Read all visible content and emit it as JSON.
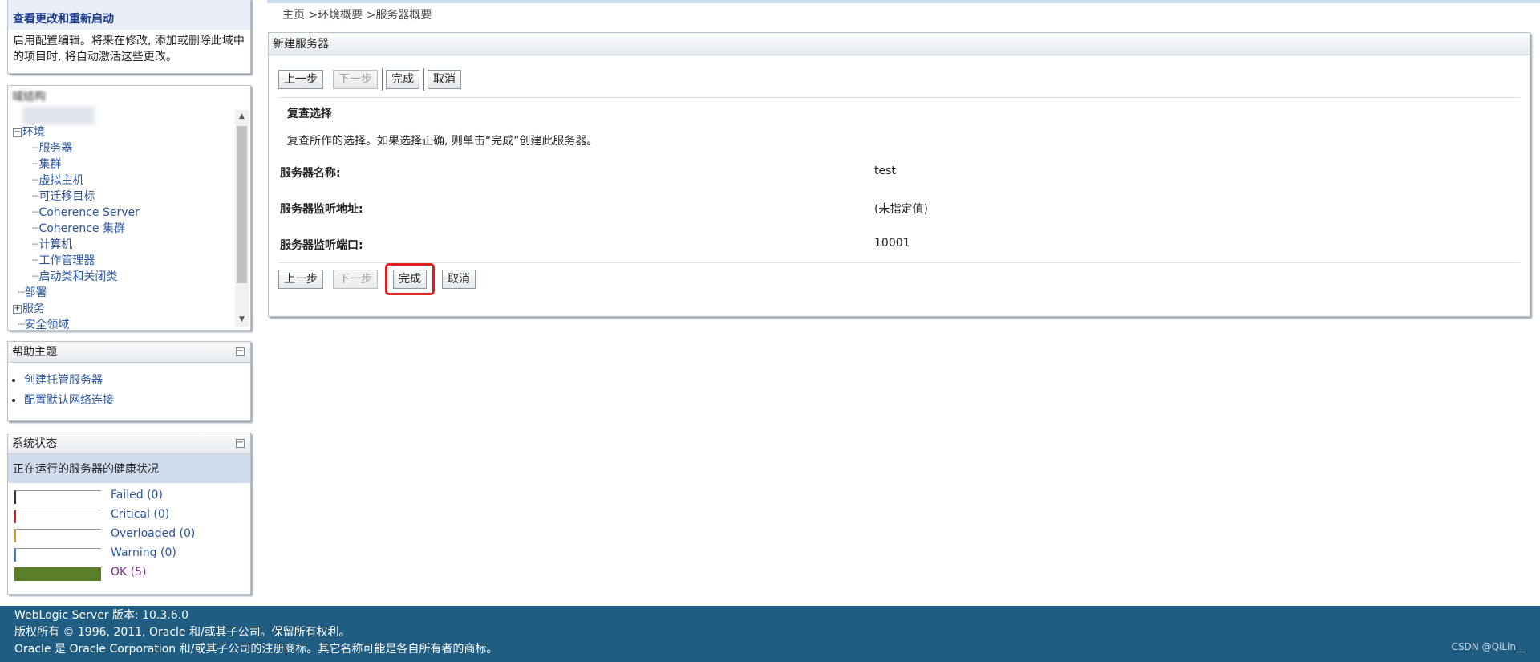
{
  "change_center": {
    "title": "查看更改和重新启动",
    "description": "启用配置编辑。将来在修改, 添加或删除此域中的项目时, 将自动激活这些更改。"
  },
  "domain_structure": {
    "title": "域结构",
    "tree": [
      {
        "label": "环境",
        "level": 0,
        "toggle": "−"
      },
      {
        "label": "服务器",
        "level": 1
      },
      {
        "label": "集群",
        "level": 1
      },
      {
        "label": "虚拟主机",
        "level": 1
      },
      {
        "label": "可迁移目标",
        "level": 1
      },
      {
        "label": "Coherence Server",
        "level": 1
      },
      {
        "label": "Coherence 集群",
        "level": 1
      },
      {
        "label": "计算机",
        "level": 1
      },
      {
        "label": "工作管理器",
        "level": 1
      },
      {
        "label": "启动类和关闭类",
        "level": 1
      },
      {
        "label": "部署",
        "level": 0
      },
      {
        "label": "服务",
        "level": 0,
        "toggle": "+"
      },
      {
        "label": "安全领域",
        "level": 0
      }
    ]
  },
  "help_topics": {
    "title": "帮助主题",
    "items": [
      "创建托管服务器",
      "配置默认网络连接"
    ]
  },
  "system_status": {
    "title": "系统状态",
    "subtitle": "正在运行的服务器的健康状况",
    "items": [
      {
        "label": "Failed (0)",
        "color": "#333333",
        "fraction": 0
      },
      {
        "label": "Critical (0)",
        "color": "#cc2222",
        "fraction": 0
      },
      {
        "label": "Overloaded (0)",
        "color": "#d4a017",
        "fraction": 0
      },
      {
        "label": "Warning (0)",
        "color": "#3a78c9",
        "fraction": 0
      },
      {
        "label": "OK (5)",
        "color": "#5a7d2a",
        "fraction": 1
      }
    ]
  },
  "breadcrumb": {
    "home": "主页",
    "sep1": " >",
    "env": "环境概要",
    "sep2": " >",
    "current": "服务器概要"
  },
  "wizard": {
    "title": "新建服务器",
    "buttons": {
      "back": "上一步",
      "next": "下一步",
      "finish": "完成",
      "cancel": "取消"
    },
    "review_title": "复查选择",
    "review_desc": "复查所作的选择。如果选择正确, 则单击“完成”创建此服务器。",
    "fields": [
      {
        "label": "服务器名称:",
        "value": "test"
      },
      {
        "label": "服务器监听地址:",
        "value": "(未指定值)"
      },
      {
        "label": "服务器监听端口:",
        "value": "10001"
      }
    ]
  },
  "footer": {
    "version": "WebLogic Server 版本: 10.3.6.0",
    "copyright": "版权所有 © 1996, 2011, Oracle 和/或其子公司。保留所有权利。",
    "trademark": "Oracle 是 Oracle Corporation 和/或其子公司的注册商标。其它名称可能是各自所有者的商标。",
    "watermark": "CSDN @QiLin__"
  }
}
